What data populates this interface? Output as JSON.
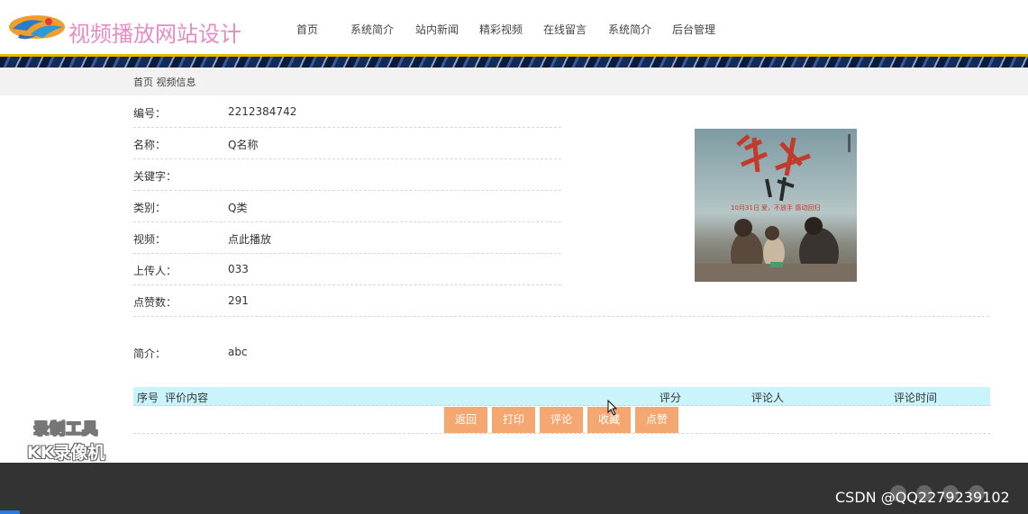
{
  "header": {
    "site_title": "视频播放网站设计",
    "nav": [
      "首页",
      "系统简介",
      "站内新闻",
      "精彩视频",
      "在线留言",
      "系统简介",
      "后台管理"
    ]
  },
  "breadcrumb": "首页 视频信息",
  "detail": {
    "rows": [
      {
        "label": "编号：",
        "value": "2212384742"
      },
      {
        "label": "名称：",
        "value": "Q名称"
      },
      {
        "label": "关键字：",
        "value": ""
      },
      {
        "label": "类别：",
        "value": "Q类"
      },
      {
        "label": "视频：",
        "value": "点此播放"
      },
      {
        "label": "上传人：",
        "value": "033"
      },
      {
        "label": "点赞数：",
        "value": "291"
      }
    ],
    "intro": {
      "label": "简介：",
      "value": "abc"
    }
  },
  "poster": {
    "date_text": "10月31日 爱，不放手 感动回归"
  },
  "comments_table": {
    "headers": [
      "序号",
      "评价内容",
      "评分",
      "评论人",
      "评论时间"
    ]
  },
  "buttons": [
    "返回",
    "打印",
    "评论",
    "收藏",
    "点赞"
  ],
  "watermark": {
    "line1": "录制工具",
    "line2": "KK录像机"
  },
  "footer": {
    "csdn": "CSDN @QQ2279239102"
  },
  "colors": {
    "accent_button": "#f5a772",
    "table_header": "#c9f4fb",
    "title_pink": "#e88bc4",
    "gold_line": "#e6b800"
  }
}
